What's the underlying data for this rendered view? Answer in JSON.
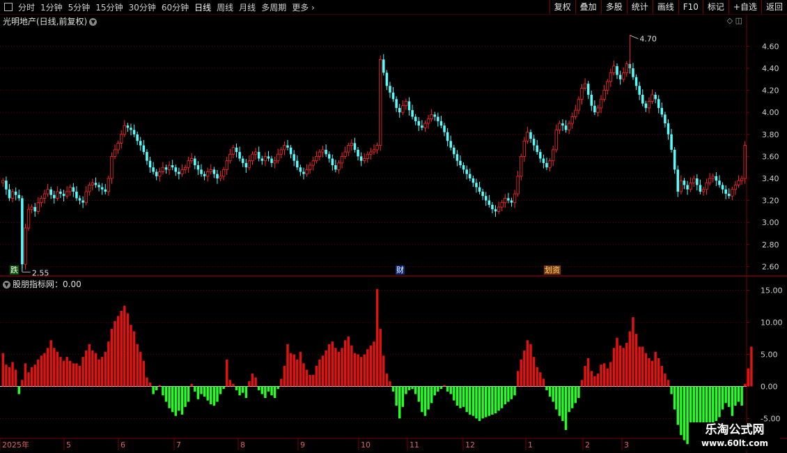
{
  "toolbar": {
    "periods": [
      "分时",
      "1分钟",
      "5分钟",
      "15分钟",
      "30分钟",
      "60分钟",
      "日线",
      "周线",
      "月线",
      "多周期",
      "更多"
    ],
    "active_period": "日线",
    "buttons": [
      "复权",
      "叠加",
      "多股",
      "统计",
      "画线",
      "F10",
      "标记",
      "+自选",
      "返回"
    ]
  },
  "main_title": "光明地产(日线,前复权)",
  "indicator_title": "股朋指标网：0.00",
  "watermark": {
    "name": "乐淘公式网",
    "url": "www.60lt.com"
  },
  "markers": {
    "low_label": "跌",
    "cai_label": "财",
    "event_label": "划资"
  },
  "colors": {
    "up": "#ff2a2a",
    "down": "#54ffff",
    "pos_bar": "#e31212",
    "neg_bar": "#22ff22",
    "grid": "#7a0000",
    "axis_text": "#d0d0d0"
  },
  "chart_data": [
    {
      "type": "candlestick",
      "ylim": [
        2.52,
        4.78
      ],
      "y_ticks": [
        2.6,
        2.8,
        3.0,
        3.2,
        3.4,
        3.6,
        3.8,
        4.0,
        4.2,
        4.4,
        4.6
      ],
      "high_annotation": {
        "value": 4.7,
        "label": "4.70"
      },
      "low_annotation": {
        "value": 2.55,
        "label": "2.55"
      },
      "close": [
        3.38,
        3.3,
        3.22,
        3.28,
        3.25,
        3.22,
        2.62,
        2.95,
        3.12,
        3.14,
        3.1,
        3.18,
        3.22,
        3.26,
        3.3,
        3.25,
        3.22,
        3.28,
        3.26,
        3.24,
        3.28,
        3.32,
        3.28,
        3.22,
        3.2,
        3.18,
        3.28,
        3.34,
        3.36,
        3.34,
        3.32,
        3.3,
        3.28,
        3.4,
        3.6,
        3.66,
        3.72,
        3.8,
        3.88,
        3.86,
        3.84,
        3.8,
        3.74,
        3.7,
        3.64,
        3.56,
        3.5,
        3.46,
        3.42,
        3.46,
        3.5,
        3.48,
        3.52,
        3.5,
        3.46,
        3.44,
        3.48,
        3.5,
        3.56,
        3.58,
        3.52,
        3.48,
        3.44,
        3.42,
        3.46,
        3.48,
        3.44,
        3.4,
        3.42,
        3.48,
        3.56,
        3.62,
        3.68,
        3.64,
        3.58,
        3.54,
        3.5,
        3.56,
        3.62,
        3.64,
        3.58,
        3.56,
        3.6,
        3.58,
        3.54,
        3.56,
        3.62,
        3.66,
        3.7,
        3.68,
        3.62,
        3.56,
        3.5,
        3.46,
        3.44,
        3.48,
        3.52,
        3.56,
        3.6,
        3.64,
        3.66,
        3.62,
        3.58,
        3.52,
        3.48,
        3.54,
        3.6,
        3.64,
        3.7,
        3.72,
        3.66,
        3.6,
        3.56,
        3.58,
        3.62,
        3.64,
        3.66,
        3.7,
        4.48,
        4.36,
        4.24,
        4.18,
        4.12,
        4.04,
        4.0,
        4.06,
        4.1,
        4.02,
        3.96,
        3.92,
        3.88,
        3.86,
        3.9,
        3.94,
        3.98,
        3.96,
        3.92,
        3.88,
        3.82,
        3.74,
        3.68,
        3.62,
        3.56,
        3.52,
        3.48,
        3.44,
        3.4,
        3.36,
        3.32,
        3.28,
        3.24,
        3.2,
        3.16,
        3.12,
        3.1,
        3.14,
        3.18,
        3.22,
        3.2,
        3.18,
        3.26,
        3.42,
        3.6,
        3.74,
        3.82,
        3.76,
        3.7,
        3.64,
        3.58,
        3.54,
        3.5,
        3.56,
        3.66,
        3.84,
        3.9,
        3.88,
        3.84,
        3.9,
        3.96,
        4.02,
        4.12,
        4.22,
        4.26,
        4.16,
        4.06,
        4.0,
        4.04,
        4.12,
        4.2,
        4.28,
        4.36,
        4.42,
        4.34,
        4.3,
        4.36,
        4.44,
        4.4,
        4.32,
        4.24,
        4.16,
        4.08,
        4.04,
        4.1,
        4.16,
        4.12,
        4.04,
        3.98,
        3.9,
        3.8,
        3.66,
        3.48,
        3.28,
        3.38,
        3.34,
        3.3,
        3.36,
        3.4,
        3.34,
        3.28,
        3.3,
        3.36,
        3.4,
        3.42,
        3.38,
        3.34,
        3.3,
        3.26,
        3.24,
        3.3,
        3.34,
        3.38,
        3.4,
        3.7
      ],
      "dates_axis": [
        "2025年",
        "5",
        "6",
        "7",
        "8",
        "9",
        "10",
        "11",
        "12",
        "1",
        "2",
        "3"
      ]
    },
    {
      "type": "bar",
      "ylim": [
        -8.0,
        16.8
      ],
      "y_ticks": [
        15.0,
        10.0,
        5.0,
        0.0,
        -5.0
      ],
      "values": [
        5.2,
        3.4,
        3.0,
        3.8,
        2.6,
        -1.2,
        1.0,
        3.6,
        2.2,
        3.0,
        3.4,
        4.2,
        4.8,
        5.2,
        6.0,
        7.2,
        6.0,
        5.4,
        4.6,
        4.0,
        4.6,
        4.0,
        3.6,
        3.6,
        3.2,
        4.6,
        5.6,
        6.6,
        5.6,
        5.2,
        4.2,
        4.6,
        5.4,
        7.0,
        9.0,
        10.2,
        11.0,
        11.8,
        12.6,
        11.4,
        9.6,
        8.6,
        6.6,
        5.4,
        4.0,
        1.4,
        0.6,
        -1.2,
        -0.6,
        0.2,
        -1.4,
        -2.4,
        -3.4,
        -4.0,
        -4.6,
        -3.8,
        -4.4,
        -3.2,
        -2.4,
        0.4,
        -0.8,
        -2.0,
        -1.2,
        -1.6,
        -2.2,
        -2.8,
        -3.0,
        -2.4,
        -1.2,
        -0.4,
        4.2,
        1.0,
        0.4,
        -0.6,
        -1.4,
        -1.0,
        -1.8,
        0.8,
        2.0,
        1.4,
        -0.6,
        -1.2,
        -1.8,
        -0.8,
        -1.4,
        -1.8,
        -0.4,
        1.2,
        3.2,
        6.6,
        5.2,
        5.0,
        4.2,
        5.4,
        3.6,
        2.6,
        1.8,
        1.8,
        3.2,
        4.2,
        4.8,
        5.6,
        6.6,
        7.0,
        6.0,
        5.4,
        6.0,
        7.2,
        7.8,
        6.4,
        5.2,
        5.0,
        4.6,
        5.0,
        5.8,
        6.4,
        7.0,
        15.2,
        9.0,
        4.8,
        2.0,
        0.8,
        -0.8,
        -3.0,
        -5.0,
        -3.2,
        -1.2,
        -0.6,
        -0.4,
        -1.2,
        -2.4,
        -4.0,
        -4.6,
        -3.6,
        -2.6,
        -1.4,
        -0.8,
        -0.4,
        0.2,
        -0.8,
        -1.2,
        -2.2,
        -3.0,
        -3.4,
        -3.2,
        -4.0,
        -4.4,
        -4.6,
        -5.0,
        -5.4,
        -5.0,
        -4.8,
        -4.6,
        -4.4,
        -4.2,
        -3.8,
        -3.4,
        -2.8,
        -2.4,
        -2.0,
        -1.4,
        2.4,
        4.2,
        5.6,
        7.2,
        6.6,
        4.6,
        3.0,
        2.2,
        1.2,
        -0.6,
        -1.6,
        -2.4,
        -3.6,
        -4.6,
        -5.4,
        -6.8,
        -4.0,
        -3.4,
        -2.6,
        -1.8,
        1.0,
        3.2,
        4.4,
        2.4,
        1.6,
        2.0,
        3.4,
        3.6,
        2.8,
        3.8,
        6.0,
        7.6,
        6.4,
        6.0,
        6.8,
        8.6,
        10.8,
        8.2,
        6.2,
        6.2,
        5.2,
        4.4,
        4.0,
        5.4,
        4.4,
        3.2,
        2.0,
        1.0,
        -1.2,
        -3.6,
        -6.0,
        -7.6,
        -8.4,
        -9.0,
        -9.6,
        -8.4,
        -7.4,
        -7.6,
        -7.2,
        -7.0,
        -6.8,
        -6.2,
        -5.4,
        -4.8,
        -3.6,
        -2.6,
        -3.2,
        -4.6,
        -3.0,
        -2.4,
        -3.0,
        0.4,
        2.8,
        6.2
      ]
    }
  ]
}
